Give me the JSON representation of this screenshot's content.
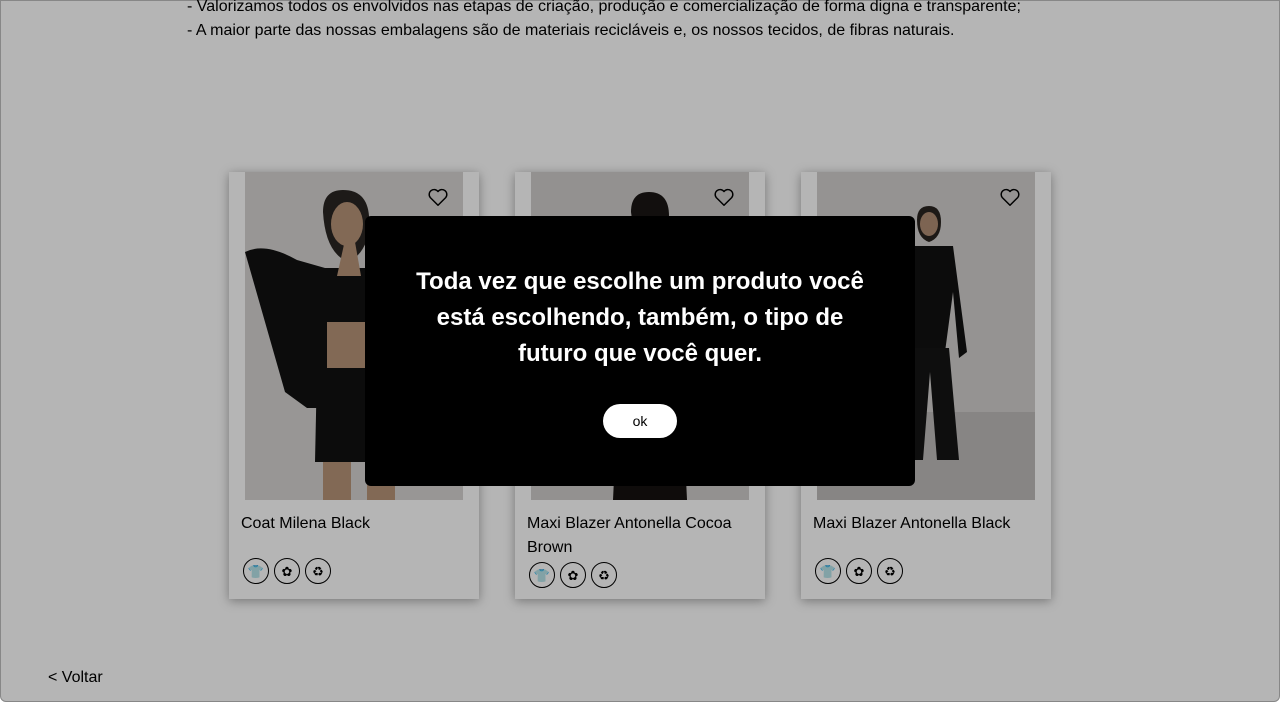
{
  "intro": {
    "lines": [
      "- Valorizamos todos os envolvidos nas etapas de criação, produção e comercialização de forma digna e transparente;",
      "- A maior parte das nossas embalagens são de materiais recicláveis e, os nossos tecidos, de fibras naturais."
    ]
  },
  "products": [
    {
      "name": "Coat Milena Black",
      "badges": [
        "👕",
        "✿",
        "♻"
      ]
    },
    {
      "name": "Maxi Blazer Antonella Cocoa Brown",
      "badges": [
        "👕",
        "✿",
        "♻"
      ]
    },
    {
      "name": "Maxi Blazer Antonella Black",
      "badges": [
        "👕",
        "✿",
        "♻"
      ]
    }
  ],
  "icons": {
    "favorite": "heart-icon",
    "badges": [
      "tshirt-icon",
      "flower-icon",
      "recycle-icon"
    ]
  },
  "footer": {
    "back_label": "< Voltar"
  },
  "modal": {
    "message": "Toda vez que escolhe um produto você está escolhendo, também, o tipo de futuro que você quer.",
    "ok_label": "ok"
  },
  "colors": {
    "modal_bg": "#000000",
    "overlay": "rgba(0,0,0,0.29)",
    "button_bg": "#ffffff"
  }
}
